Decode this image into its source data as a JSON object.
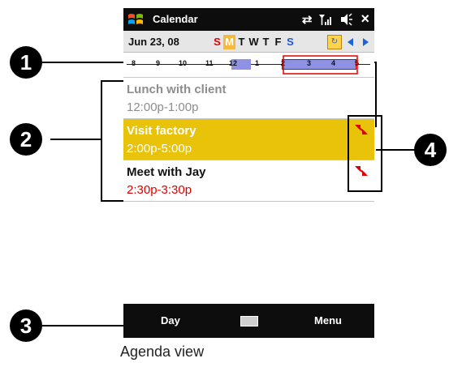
{
  "title_bar": {
    "app_title": "Calendar",
    "start_icon": "windows-logo-icon",
    "status_icons": [
      "sync-arrows-icon",
      "signal-icon",
      "volume-icon"
    ],
    "close_label": "×"
  },
  "date_bar": {
    "date": "Jun 23, 08",
    "days": [
      {
        "label": "S",
        "kind": "weekend"
      },
      {
        "label": "M",
        "kind": "today"
      },
      {
        "label": "T",
        "kind": "weekday"
      },
      {
        "label": "W",
        "kind": "weekday"
      },
      {
        "label": "T",
        "kind": "weekday"
      },
      {
        "label": "F",
        "kind": "weekday"
      },
      {
        "label": "S",
        "kind": "saturday"
      }
    ],
    "nav_icons": [
      "go-to-today-icon",
      "previous-arrow-icon",
      "next-arrow-icon"
    ]
  },
  "timeline": {
    "hours": [
      "8",
      "9",
      "10",
      "11",
      "12",
      "1",
      "2",
      "3",
      "4",
      "5"
    ]
  },
  "appointments": [
    {
      "subject": "Lunch with client",
      "time": "12:00p-1:00p",
      "state": "past",
      "conflict": false
    },
    {
      "subject": "Visit factory",
      "time": "2:00p-5:00p",
      "state": "selected",
      "conflict": true
    },
    {
      "subject": "Meet with Jay",
      "time": "2:30p-3:30p",
      "state": "normal",
      "conflict": true
    }
  ],
  "soft_keys": {
    "left": "Day",
    "center_icon": "keyboard-icon",
    "right": "Menu"
  },
  "callouts": [
    "1",
    "2",
    "3",
    "4"
  ],
  "caption": "Agenda view",
  "colors": {
    "selected": "#e8c30a",
    "conflict_red": "#e00000",
    "timeline_block": "#8f92e2",
    "today": "#f6b93b"
  }
}
